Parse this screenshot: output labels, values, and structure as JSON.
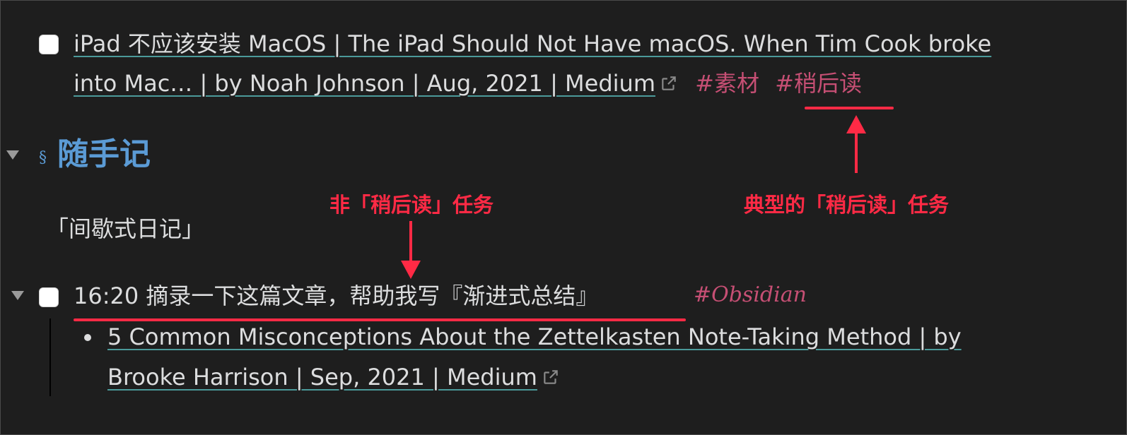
{
  "tasks": [
    {
      "link_line1": "iPad 不应该安装 MacOS | The iPad Should Not Have macOS. When Tim Cook broke",
      "link_line2": "into Mac… | by Noah Johnson | Aug, 2021 | Medium",
      "tag1": "#素材",
      "tag2": "#稍后读"
    },
    {
      "text": "16:20 摘录一下这篇文章，帮助我写『渐进式总结』",
      "tag": "#Obsidian"
    }
  ],
  "section": {
    "icon": "§",
    "heading": "随手记",
    "paragraph": "「间歇式日记」"
  },
  "subitem": {
    "link_line1": "5 Common Misconceptions About the Zettelkasten Note-Taking Method | by",
    "link_line2": "Brooke Harrison | Sep, 2021 | Medium"
  },
  "annotations": {
    "typical": "典型的「稍后读」任务",
    "non_typical": "非「稍后读」任务"
  },
  "colors": {
    "background": "#1e1e1e",
    "text": "#dcddde",
    "link_underline": "#4b9a9a",
    "tag": "#c64f74",
    "heading": "#5b9bd5",
    "annotation": "#ff2a45"
  },
  "icons": {
    "external_link": "external-link-icon",
    "fold": "fold-triangle-icon",
    "section": "section-sign-icon"
  }
}
